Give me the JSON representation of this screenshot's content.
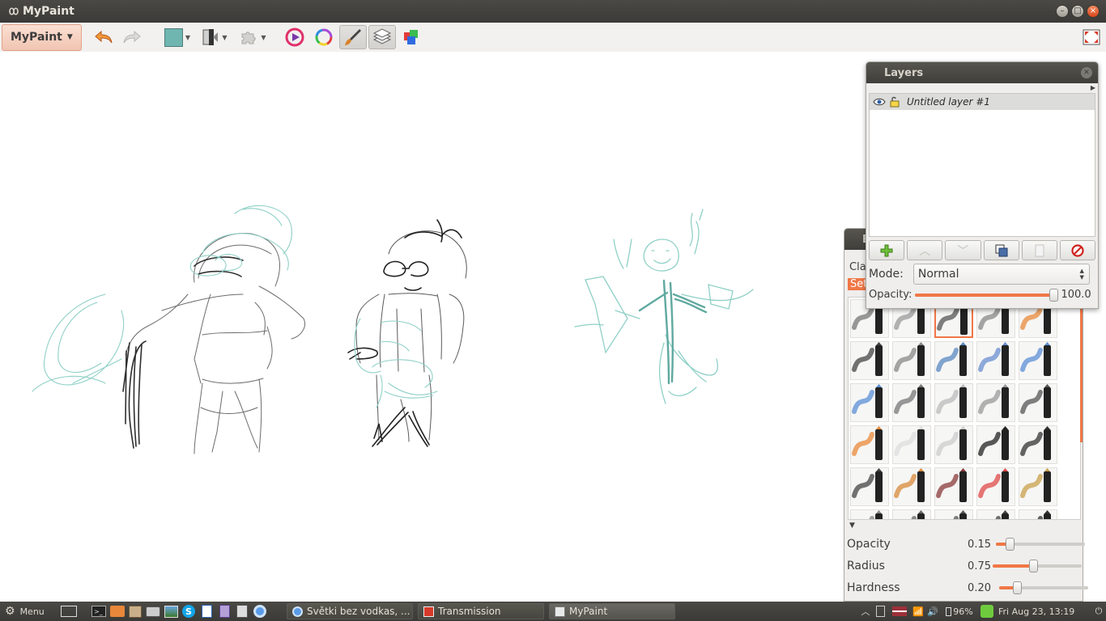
{
  "window": {
    "title": "MyPaint"
  },
  "toolbar": {
    "menu_label": "MyPaint",
    "current_color": "#6fb5b0"
  },
  "layers_panel": {
    "title": "Layers",
    "layers": [
      {
        "name": "Untitled layer #1",
        "visible": true,
        "locked": false
      }
    ],
    "mode_label": "Mode:",
    "mode_value": "Normal",
    "opacity_label": "Opacity:",
    "opacity_value": "100.0",
    "opacity_fraction": 1.0
  },
  "brush_panel": {
    "title_partial": "B",
    "group_tab_1": "Cla",
    "group_tab_2": "Set",
    "settings": [
      {
        "label": "Opacity",
        "value": "0.15",
        "fraction": 0.15
      },
      {
        "label": "Radius",
        "value": "0.75",
        "fraction": 0.45
      },
      {
        "label": "Hardness",
        "value": "0.20",
        "fraction": 0.2
      }
    ]
  },
  "taskbar": {
    "menu_label": "Menu",
    "tasks": [
      {
        "label": "Světki bez vodkas, ...",
        "icon": "chromium-icon"
      },
      {
        "label": "Transmission",
        "icon": "transmission-icon"
      },
      {
        "label": "MyPaint",
        "icon": "mypaint-icon"
      }
    ],
    "battery": "96%",
    "clock": "Fri Aug 23, 13:19"
  },
  "colors": {
    "accent": "#f07746",
    "titlebar": "#3c3b37",
    "sketch_teal": "#7fc4bc",
    "sketch_pencil": "#555555"
  }
}
